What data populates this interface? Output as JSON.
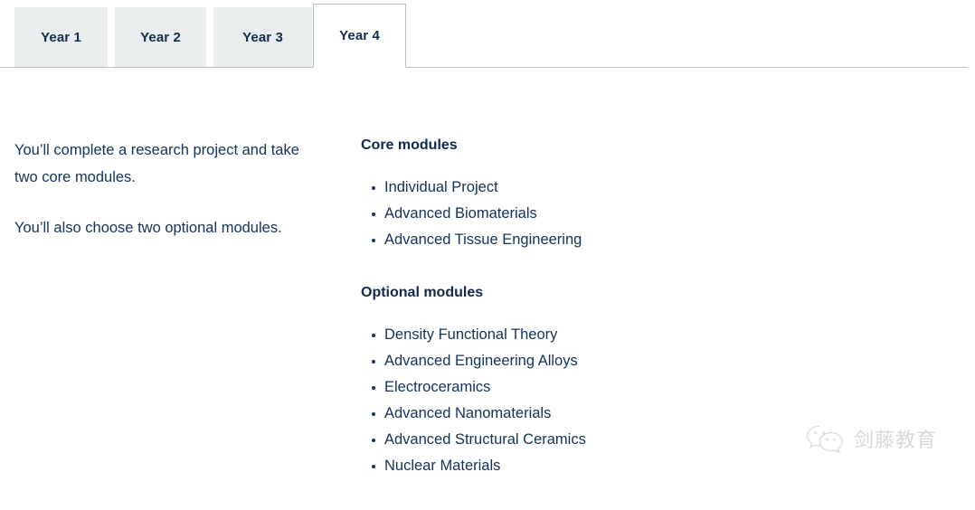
{
  "tabs": [
    {
      "label": "Year 1",
      "active": false
    },
    {
      "label": "Year 2",
      "active": false
    },
    {
      "label": "Year 3",
      "active": false
    },
    {
      "label": "Year 4",
      "active": true
    }
  ],
  "intro": {
    "paragraph_1": "You’ll complete a research project and take two core modules.",
    "paragraph_2": "You’ll also choose two optional modules."
  },
  "core": {
    "heading": "Core modules",
    "items": [
      "Individual Project",
      "Advanced Biomaterials",
      "Advanced Tissue Engineering"
    ]
  },
  "optional": {
    "heading": "Optional modules",
    "items": [
      "Density Functional Theory",
      "Advanced Engineering Alloys",
      "Electroceramics",
      "Advanced Nanomaterials",
      "Advanced Structural Ceramics",
      "Nuclear Materials"
    ]
  },
  "watermark": {
    "icon": "wechat-icon",
    "text": "剑藤教育"
  },
  "colors": {
    "text_navy": "#12335a",
    "heading_navy": "#0f2a4d",
    "tab_inactive_bg": "#e9edee",
    "tab_active_bg": "#ffffff",
    "border_gray": "#b9c0c5",
    "watermark_gray": "#c3c3c3",
    "page_bg": "#ffffff"
  }
}
